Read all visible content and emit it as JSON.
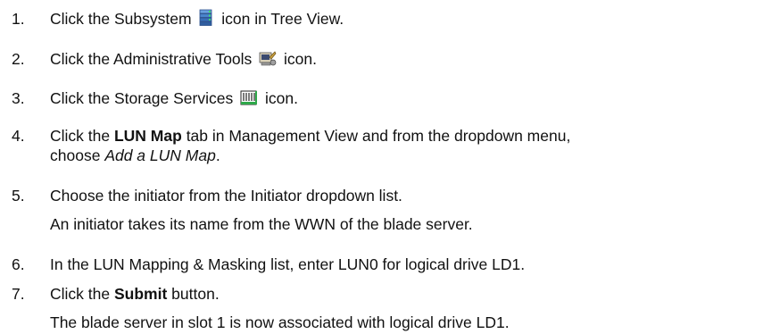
{
  "steps": [
    {
      "num": "1.",
      "pre": "Click the Subsystem",
      "icon": "subsystem-icon",
      "post": "icon in Tree View."
    },
    {
      "num": "2.",
      "pre": "Click the Administrative Tools",
      "icon": "administrative-tools-icon",
      "post": "icon."
    },
    {
      "num": "3.",
      "pre": "Click the Storage Services",
      "icon": "storage-services-icon",
      "post": "icon."
    },
    {
      "num": "4.",
      "pre": "Click the",
      "bold": "LUN Map",
      "mid": "tab in Management View and from the dropdown menu,",
      "line2_pre": "choose",
      "line2_italic": "Add a LUN Map",
      "line2_post": "."
    },
    {
      "num": "5.",
      "text": "Choose the initiator from the Initiator dropdown list.",
      "note": "An initiator takes its name from the WWN of the blade server."
    },
    {
      "num": "6.",
      "text": "In the LUN Mapping & Masking list, enter LUN0 for logical drive LD1."
    },
    {
      "num": "7.",
      "pre": "Click the",
      "bold": "Submit",
      "post": "button.",
      "note": "The blade server in slot 1 is now associated with logical drive LD1."
    }
  ],
  "colors": {
    "text": "#111111",
    "subsystem_icon": "#3a6fb8",
    "admin_icon": "#c8a040",
    "storage_icon": "#2fa84a"
  }
}
